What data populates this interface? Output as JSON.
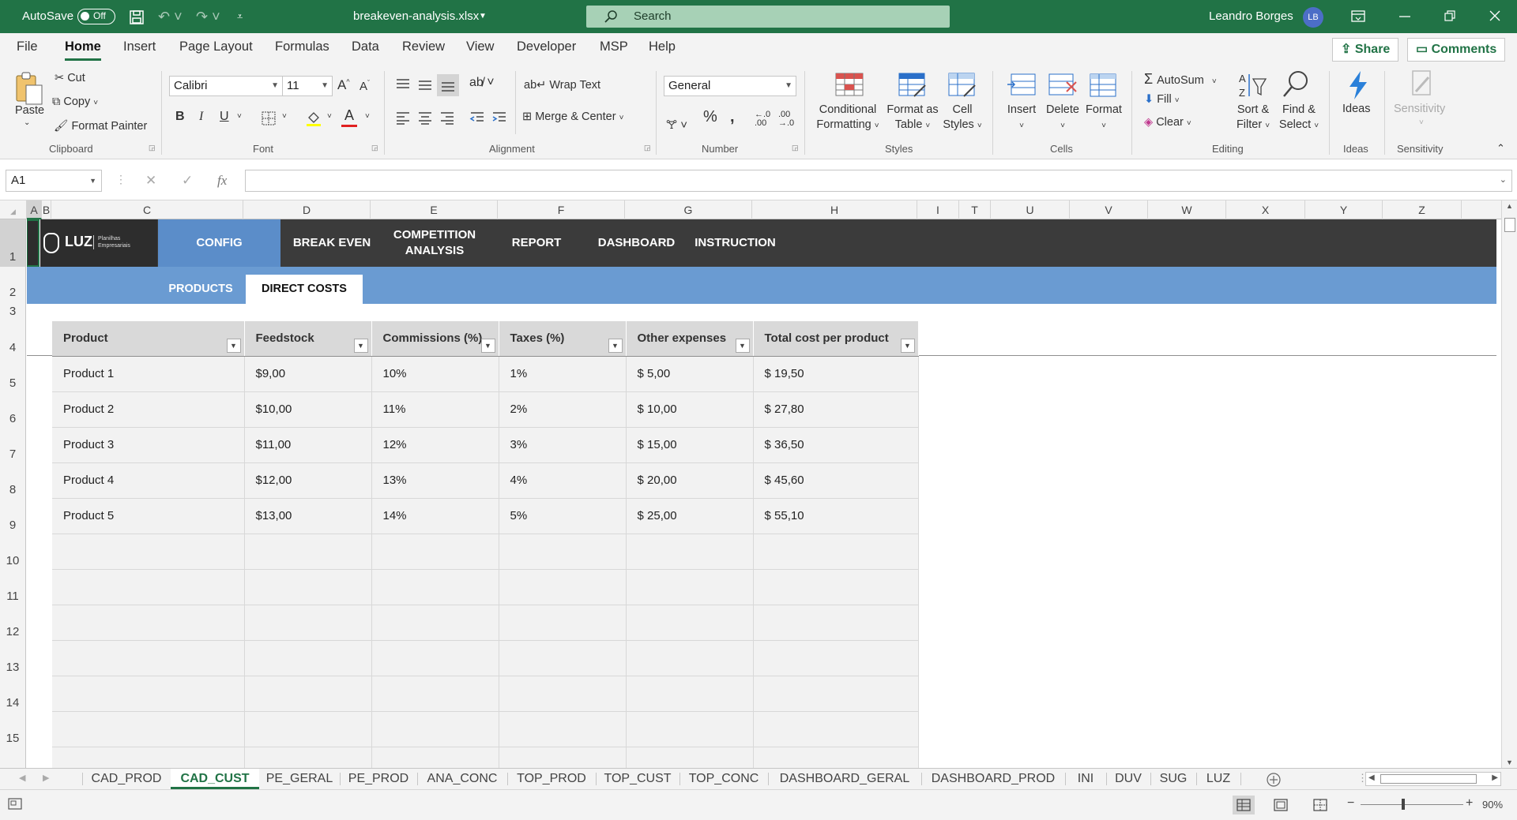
{
  "titlebar": {
    "autosave_label": "AutoSave",
    "autosave_state": "Off",
    "filename": "breakeven-analysis.xlsx",
    "search_placeholder": "Search",
    "user_name": "Leandro Borges",
    "user_initials": "LB"
  },
  "menu": {
    "items": [
      "File",
      "Home",
      "Insert",
      "Page Layout",
      "Formulas",
      "Data",
      "Review",
      "View",
      "Developer",
      "MSP",
      "Help"
    ],
    "active": "Home",
    "share_label": "Share",
    "comments_label": "Comments"
  },
  "ribbon": {
    "clipboard": {
      "paste": "Paste",
      "cut": "Cut",
      "copy": "Copy",
      "format_painter": "Format Painter",
      "group": "Clipboard"
    },
    "font": {
      "name": "Calibri",
      "size": "11",
      "group": "Font"
    },
    "alignment": {
      "wrap_text": "Wrap Text",
      "merge_center": "Merge & Center",
      "group": "Alignment"
    },
    "number": {
      "format": "General",
      "group": "Number"
    },
    "styles": {
      "conditional_1": "Conditional",
      "conditional_2": "Formatting",
      "format_table_1": "Format as",
      "format_table_2": "Table",
      "cell_styles_1": "Cell",
      "cell_styles_2": "Styles",
      "group": "Styles"
    },
    "cells": {
      "insert": "Insert",
      "delete": "Delete",
      "format": "Format",
      "group": "Cells"
    },
    "editing": {
      "autosum": "AutoSum",
      "fill": "Fill",
      "clear": "Clear",
      "sort_1": "Sort &",
      "sort_2": "Filter",
      "find_1": "Find &",
      "find_2": "Select",
      "group": "Editing"
    },
    "ideas": {
      "label": "Ideas",
      "group": "Ideas"
    },
    "sensitivity": {
      "label": "Sensitivity",
      "group": "Sensitivity"
    }
  },
  "formula_bar": {
    "name_box": "A1",
    "fx": "fx",
    "value": ""
  },
  "columns": [
    "A",
    "B",
    "C",
    "D",
    "E",
    "F",
    "G",
    "H",
    "I",
    "T",
    "U",
    "V",
    "W",
    "X",
    "Y",
    "Z"
  ],
  "rows": [
    "1",
    "2",
    "3",
    "4",
    "5",
    "6",
    "7",
    "8",
    "9",
    "10",
    "11",
    "12",
    "13",
    "14",
    "15"
  ],
  "sheet_nav": {
    "logo_text": "LUZ",
    "logo_sub_1": "Planilhas",
    "logo_sub_2": "Empresariais",
    "tabs": [
      "CONFIG",
      "BREAK EVEN",
      "COMPETITION ANALYSIS",
      "REPORT",
      "DASHBOARD",
      "INSTRUCTION"
    ],
    "active": "CONFIG",
    "subtabs": [
      "PRODUCTS",
      "DIRECT COSTS"
    ],
    "active_subtab": "DIRECT COSTS"
  },
  "table": {
    "headers": [
      "Product",
      "Feedstock",
      "Commissions (%)",
      "Taxes (%)",
      "Other expenses",
      "Total cost per product"
    ],
    "rows": [
      [
        "Product 1",
        "$9,00",
        "10%",
        "1%",
        "$ 5,00",
        "$ 19,50"
      ],
      [
        "Product 2",
        "$10,00",
        "11%",
        "2%",
        "$ 10,00",
        "$ 27,80"
      ],
      [
        "Product 3",
        "$11,00",
        "12%",
        "3%",
        "$ 15,00",
        "$ 36,50"
      ],
      [
        "Product 4",
        "$12,00",
        "13%",
        "4%",
        "$ 20,00",
        "$ 45,60"
      ],
      [
        "Product 5",
        "$13,00",
        "14%",
        "5%",
        "$ 25,00",
        "$ 55,10"
      ]
    ]
  },
  "sheets": {
    "tabs": [
      "CAD_PROD",
      "CAD_CUST",
      "PE_GERAL",
      "PE_PROD",
      "ANA_CONC",
      "TOP_PROD",
      "TOP_CUST",
      "TOP_CONC",
      "DASHBOARD_GERAL",
      "DASHBOARD_PROD",
      "INI",
      "DUV",
      "SUG",
      "LUZ"
    ],
    "active": "CAD_CUST"
  },
  "status": {
    "zoom": "90%"
  },
  "colors": {
    "excel_green": "#217346",
    "nav_dark": "#3b3b3b",
    "nav_active": "#5b8dc9",
    "subbar": "#6a9bd2",
    "header_gray": "#d9d9d9"
  }
}
